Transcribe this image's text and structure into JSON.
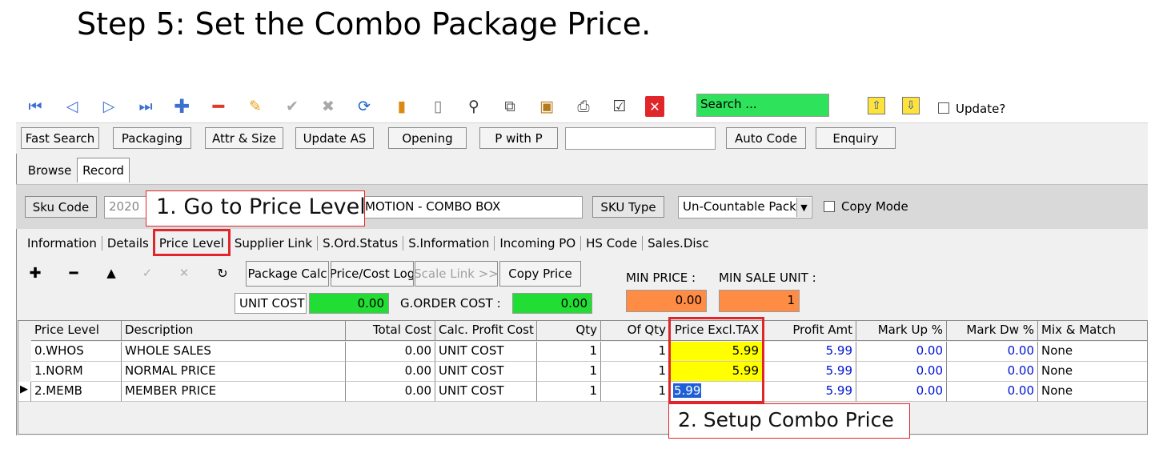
{
  "heading": "Step 5: Set the Combo Package Price.",
  "toolbar": {
    "search_placeholder": "Search ...",
    "update_label": "Update?"
  },
  "buttons": {
    "fast_search": "Fast Search",
    "packaging": "Packaging",
    "attr_size": "Attr & Size",
    "update_as": "Update AS",
    "opening": "Opening",
    "p_with_p": "P with P",
    "auto_code": "Auto Code",
    "enquiry": "Enquiry"
  },
  "tabs": {
    "browse": "Browse",
    "record": "Record"
  },
  "sku": {
    "code_label": "Sku Code",
    "code_value": "2020",
    "description_value": "MOTION - COMBO BOX",
    "type_label": "SKU Type",
    "type_value": "Un-Countable Pack",
    "copy_mode_label": "Copy Mode"
  },
  "subtabs": [
    "Information",
    "Details",
    "Price Level",
    "Supplier Link",
    "S.Ord.Status",
    "S.Information",
    "Incoming PO",
    "HS Code",
    "Sales.Disc"
  ],
  "price_toolbar": {
    "package_calc": "Package Calc",
    "price_cost_log": "Price/Cost Log",
    "scale_link": "Scale Link >>",
    "copy_price": "Copy Price",
    "min_price_label": "MIN PRICE :",
    "min_sale_unit_label": "MIN SALE UNIT :",
    "unit_cost_label": "UNIT COST",
    "unit_cost_value": "0.00",
    "g_order_cost_label": "G.ORDER COST :",
    "g_order_cost_value": "0.00",
    "min_price_value": "0.00",
    "min_sale_unit_value": "1"
  },
  "grid": {
    "headers": [
      "Price Level",
      "Description",
      "Total Cost",
      "Calc. Profit Cost",
      "Qty",
      "Of Qty",
      "Price Excl.TAX",
      "Profit Amt",
      "Mark Up %",
      "Mark Dw %",
      "Mix & Match"
    ],
    "rows": [
      {
        "level": "0.WHOS",
        "desc": "WHOLE SALES",
        "total_cost": "0.00",
        "calc": "UNIT COST",
        "qty": "1",
        "of_qty": "1",
        "price": "5.99",
        "profit": "5.99",
        "markup": "0.00",
        "markdw": "0.00",
        "mix": "None"
      },
      {
        "level": "1.NORM",
        "desc": "NORMAL PRICE",
        "total_cost": "0.00",
        "calc": "UNIT COST",
        "qty": "1",
        "of_qty": "1",
        "price": "5.99",
        "profit": "5.99",
        "markup": "0.00",
        "markdw": "0.00",
        "mix": "None"
      },
      {
        "level": "2.MEMB",
        "desc": "MEMBER PRICE",
        "total_cost": "0.00",
        "calc": "UNIT COST",
        "qty": "1",
        "of_qty": "1",
        "price": "5.99",
        "profit": "5.99",
        "markup": "0.00",
        "markdw": "0.00",
        "mix": "None"
      }
    ]
  },
  "annotations": {
    "step1": "1. Go to Price Level",
    "step2": "2. Setup Combo Price"
  },
  "colors": {
    "annotation_red": "#e0262b",
    "search_green": "#2ee35b",
    "cost_green": "#22dd33",
    "orange": "#ff8c45",
    "price_yellow": "#ffff00",
    "value_blue": "#0015d6"
  }
}
